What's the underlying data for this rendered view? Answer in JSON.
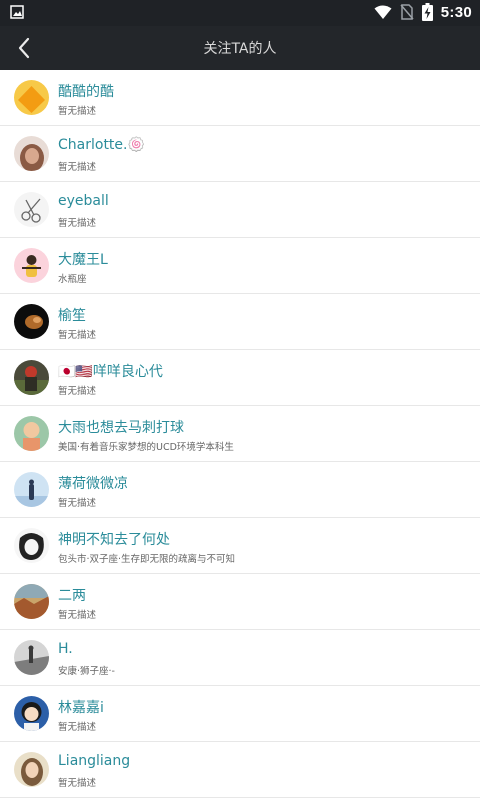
{
  "status_bar": {
    "time": "5:30",
    "icons": [
      "image-icon",
      "wifi-icon",
      "no-sim-icon",
      "battery-charging-icon"
    ]
  },
  "header": {
    "title": "关注TA的人",
    "back_icon": "chevron-left-icon"
  },
  "colors": {
    "status_bar_bg": "#1f2226",
    "header_bg": "#23262a",
    "name_color": "#2b8c9a",
    "desc_color": "#666666",
    "divider": "#e7e7e7"
  },
  "followers": [
    {
      "name": "酷酷的酷",
      "desc": "暂无描述"
    },
    {
      "name": "Charlotte.🍥",
      "desc": "暂无描述"
    },
    {
      "name": "eyeball",
      "desc": "暂无描述"
    },
    {
      "name": "大魔王L",
      "desc": "水瓶座"
    },
    {
      "name": "榆笙",
      "desc": "暂无描述"
    },
    {
      "name": "🇯🇵🇺🇸咩咩良心代",
      "desc": "暂无描述"
    },
    {
      "name": "大雨也想去马刺打球",
      "desc": "美国·有着音乐家梦想的UCD环境学本科生"
    },
    {
      "name": "薄荷微微凉",
      "desc": "暂无描述"
    },
    {
      "name": "神明不知去了何处",
      "desc": "包头市·双子座·生存即无限的疏离与不可知"
    },
    {
      "name": "二两",
      "desc": "暂无描述"
    },
    {
      "name": "H.",
      "desc": "安康·狮子座·-"
    },
    {
      "name": "林嘉嘉i",
      "desc": "暂无描述"
    },
    {
      "name": "Liangliang",
      "desc": "暂无描述"
    }
  ]
}
